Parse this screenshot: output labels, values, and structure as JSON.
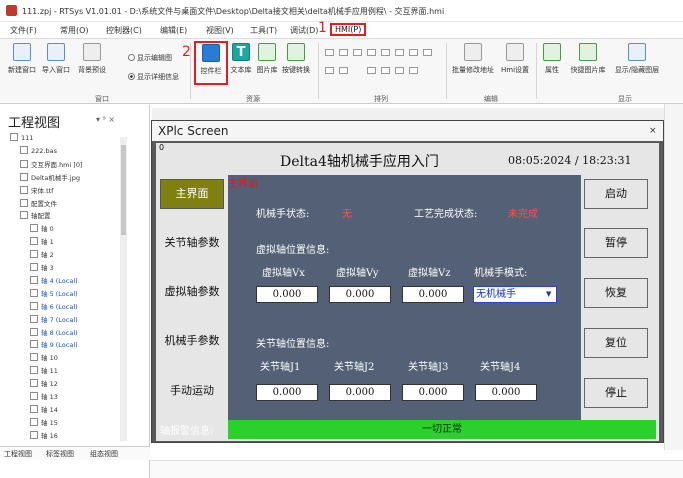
{
  "app": {
    "title": "111.zpj - RTSys V1.01.01 - D:\\系统文件与桌面文件\\Desktop\\Delta接文相关\\delta机械手应用例程\\ - 交互界面.hmi"
  },
  "menu": [
    "文件(F)",
    "常用(O)",
    "控制器(C)",
    "编辑(E)",
    "视图(V)",
    "工具(T)",
    "调试(D)",
    "HMI(P)"
  ],
  "annotations": {
    "mark1": "1",
    "mark2": "2"
  },
  "ribbon": {
    "buttons": {
      "new_window": "新建窗口",
      "import_window": "导入窗口",
      "bg_display": "背景预设",
      "control": "控件栏",
      "text_lib": "文本库",
      "image_lib": "图片库",
      "button_convert": "按键转换",
      "batch_modify": "批量修改地址",
      "hmi_settings": "Hmi设置",
      "properties": "属性",
      "quick_image_lib": "快捷图片库",
      "show_hide_layer": "显示/隐藏图层"
    },
    "radios": {
      "show_number": "显示编辑图",
      "show_detail": "显示详细信息"
    },
    "groups": {
      "window": "窗口",
      "resource": "资源",
      "arrange": "排列",
      "edit": "编辑",
      "display": "显示"
    }
  },
  "panel": {
    "title": "工程视图",
    "controls": "▾ ⁹ ×",
    "tree": [
      {
        "label": "111",
        "local": false
      },
      {
        "label": "222.bas",
        "local": false
      },
      {
        "label": "交互界面.hmi [0]",
        "local": false
      },
      {
        "label": "Delta机械手.jpg",
        "local": false
      },
      {
        "label": "宋体.ttf",
        "local": false
      },
      {
        "label": "配置文件",
        "local": false
      },
      {
        "label": "轴配置",
        "local": false
      },
      {
        "label": "轴 0",
        "local": false
      },
      {
        "label": "轴 1",
        "local": false
      },
      {
        "label": "轴 2",
        "local": false
      },
      {
        "label": "轴 3",
        "local": false
      },
      {
        "label": "轴 4 (Local)",
        "local": true
      },
      {
        "label": "轴 5 (Local)",
        "local": true
      },
      {
        "label": "轴 6 (Local)",
        "local": true
      },
      {
        "label": "轴 7 (Local)",
        "local": true
      },
      {
        "label": "轴 8 (Local)",
        "local": true
      },
      {
        "label": "轴 9 (Local)",
        "local": true
      },
      {
        "label": "轴 10",
        "local": false
      },
      {
        "label": "轴 11",
        "local": false
      },
      {
        "label": "轴 12",
        "local": false
      },
      {
        "label": "轴 13",
        "local": false
      },
      {
        "label": "轴 14",
        "local": false
      },
      {
        "label": "轴 15",
        "local": false
      },
      {
        "label": "轴 16",
        "local": false
      }
    ],
    "tabs": [
      "工程视图",
      "标签视图",
      "组态视图"
    ]
  },
  "xplc": {
    "title": "XPlc Screen",
    "close": "×",
    "zero": "0",
    "header_title": "Delta4轴机械手应用入门",
    "time": "08:05:2024  /  18:23:31",
    "nav": [
      "主界面",
      "关节轴参数",
      "虚拟轴参数",
      "机械手参数",
      "手动运动"
    ],
    "content_label": "主界面",
    "robot_status_label": "机械手状态:",
    "robot_status_value": "无",
    "process_status_label": "工艺完成状态:",
    "process_status_value": "未完成",
    "virtual_title": "虚拟轴位置信息:",
    "virtual_headers": [
      "虚拟轴Vx",
      "虚拟轴Vy",
      "虚拟轴Vz"
    ],
    "virtual_values": [
      "0.000",
      "0.000",
      "0.000"
    ],
    "mode_label": "机械手模式:",
    "mode_value": "无机械手",
    "joint_title": "关节轴位置信息:",
    "joint_headers": [
      "关节轴J1",
      "关节轴J2",
      "关节轴J3",
      "关节轴J4"
    ],
    "joint_values": [
      "0.000",
      "0.000",
      "0.000",
      "0.000"
    ],
    "right_buttons": [
      "启动",
      "暂停",
      "恢复",
      "复位",
      "停止"
    ],
    "alarm_label": "轴报警信息:",
    "alarm_status": "一切正常"
  }
}
